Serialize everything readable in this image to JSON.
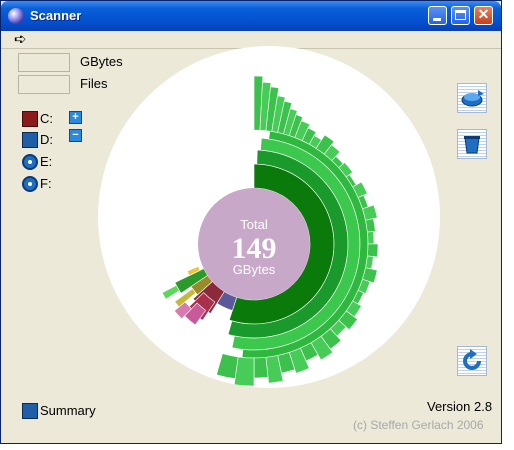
{
  "window": {
    "title": "Scanner"
  },
  "info": {
    "size_unit": "GBytes",
    "files_label": "Files"
  },
  "drives": [
    {
      "label": "C:",
      "icon": "hard-drive-red-icon"
    },
    {
      "label": "D:",
      "icon": "hard-drive-blue-icon"
    },
    {
      "label": "E:",
      "icon": "optical-disc-icon"
    },
    {
      "label": "F:",
      "icon": "optical-disc-icon"
    }
  ],
  "zoom": {
    "plus": "+",
    "minus": "−"
  },
  "tools": [
    "save-icon",
    "trash-icon",
    "refresh-icon"
  ],
  "center": {
    "label": "Total",
    "value": "149",
    "unit": "GBytes"
  },
  "summary": {
    "label": "Summary"
  },
  "footer": {
    "version": "Version 2.8",
    "copyright": "(c) Steffen Gerlach 2006"
  },
  "colors": {
    "center": "#c8a8c8",
    "green_inner": "#0a7a0a",
    "green_mid": "#1a9a2a",
    "green_outer": "#3cc84c",
    "maroon": "#8b2a3a",
    "pink": "#c85a9a"
  }
}
